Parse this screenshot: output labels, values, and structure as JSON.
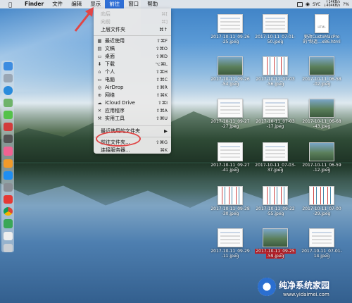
{
  "menubar": {
    "app_name": "Finder",
    "items": [
      "文件",
      "编辑",
      "显示",
      "前往",
      "窗口",
      "帮助"
    ],
    "active_item": "前往",
    "status_net_up": "↑14KB/s",
    "status_net_down": "↓404KB/s",
    "status_sync": "SYC",
    "status_percent": "?%"
  },
  "go_menu": {
    "items": [
      {
        "label": "向后",
        "shortcut": "⌘[",
        "enabled": false,
        "icon": ""
      },
      {
        "label": "向前",
        "shortcut": "⌘]",
        "enabled": false,
        "icon": ""
      },
      {
        "label": "上层文件夹",
        "shortcut": "⌘↑",
        "enabled": true,
        "icon": ""
      },
      {
        "label": "最近使用",
        "shortcut": "⇧⌘F",
        "enabled": true,
        "icon": "recents-icon"
      },
      {
        "label": "文稿",
        "shortcut": "⇧⌘O",
        "enabled": true,
        "icon": "documents-icon"
      },
      {
        "label": "桌面",
        "shortcut": "⇧⌘D",
        "enabled": true,
        "icon": "desktop-icon"
      },
      {
        "label": "下载",
        "shortcut": "⌥⌘L",
        "enabled": true,
        "icon": "downloads-icon"
      },
      {
        "label": "个人",
        "shortcut": "⇧⌘H",
        "enabled": true,
        "icon": "home-icon"
      },
      {
        "label": "电脑",
        "shortcut": "⇧⌘C",
        "enabled": true,
        "icon": "computer-icon"
      },
      {
        "label": "AirDrop",
        "shortcut": "⇧⌘R",
        "enabled": true,
        "icon": "airdrop-icon"
      },
      {
        "label": "网络",
        "shortcut": "⇧⌘K",
        "enabled": true,
        "icon": "network-icon"
      },
      {
        "label": "iCloud Drive",
        "shortcut": "⇧⌘I",
        "enabled": true,
        "icon": "icloud-icon"
      },
      {
        "label": "应用程序",
        "shortcut": "⇧⌘A",
        "enabled": true,
        "icon": "applications-icon"
      },
      {
        "label": "实用工具",
        "shortcut": "⇧⌘U",
        "enabled": true,
        "icon": "utilities-icon"
      },
      {
        "label": "最近使用的文件夹",
        "shortcut": "▶",
        "enabled": true,
        "icon": ""
      },
      {
        "label": "前往文件夹...",
        "shortcut": "⇧⌘G",
        "enabled": true,
        "icon": ""
      },
      {
        "label": "连接服务器...",
        "shortcut": "⌘K",
        "enabled": true,
        "icon": ""
      }
    ]
  },
  "desktop_files": [
    {
      "name": "2017-10-11_09-26-25.jpeg",
      "line1": "2017-10-11_09-26",
      "line2": "-25.jpeg",
      "kind": "shot"
    },
    {
      "name": "2017-10-11_07-01-50.jpeg",
      "line1": "2017-10-11_07-01-",
      "line2": "50.jpeg",
      "kind": "shot"
    },
    {
      "name": "更改CustoMacPro的\"制造...x86.html",
      "line1": "更改CustoMacPro",
      "line2": "的\"制造...x86.html",
      "kind": "doc"
    },
    {
      "name": "2017-10-11_09-26-54.jpeg",
      "line1": "2017-10-11_09-26",
      "line2": "-54.jpeg",
      "kind": "photo"
    },
    {
      "name": "2017-10-11_07-03-56.jpeg",
      "line1": "2017-10-11_07-03",
      "line2": "-56.jpeg",
      "kind": "grid"
    },
    {
      "name": "2017-10-11_06-58-02.jpeg",
      "line1": "2017-10-11_06-58",
      "line2": "-02.jpeg",
      "kind": "photo"
    },
    {
      "name": "2017-10-11_09-27-27.jpeg",
      "line1": "2017-10-11_09-27",
      "line2": "-27.jpeg",
      "kind": "shot"
    },
    {
      "name": "2017-10-11_07-03-17.jpeg",
      "line1": "2017-10-11_07-03",
      "line2": "-17.jpeg",
      "kind": "shot"
    },
    {
      "name": "2017-10-11_06-68-43.jpeg",
      "line1": "2017-10-11_06-68",
      "line2": "-43.jpeg",
      "kind": "photo"
    },
    {
      "name": "2017-10-11_09-27-41.jpeg",
      "line1": "2017-10-11_09-27",
      "line2": "-41.jpeg",
      "kind": "shot"
    },
    {
      "name": "2017-10-11_07-03-37.jpeg",
      "line1": "2017-10-11_07-03-",
      "line2": "37.jpeg",
      "kind": "shot"
    },
    {
      "name": "2017-10-11_06-59-12.jpeg",
      "line1": "2017-10-11_06-59",
      "line2": "-12.jpeg",
      "kind": "photo"
    },
    {
      "name": "2017-10-11_09-28-30.jpeg",
      "line1": "2017-10-11_09-28",
      "line2": "-30.jpeg",
      "kind": "grid"
    },
    {
      "name": "2017-10-11_09-22-55.jpeg",
      "line1": "2017-10-11_09-22",
      "line2": "-55.jpeg",
      "kind": "grid"
    },
    {
      "name": "2017-10-11_07-00-29.jpeg",
      "line1": "2017-10-11_07-00",
      "line2": "-29.jpeg",
      "kind": "grid"
    },
    {
      "name": "2017-10-11_09-29-11.jpeg",
      "line1": "2017-10-11_09-29",
      "line2": "-11.jpeg",
      "kind": "shot"
    },
    {
      "name": "2017-10-11_09-25-59.jpeg",
      "line1": "2017-10-11_09-25",
      "line2": "-59.jpeg",
      "kind": "photo",
      "selected": true
    },
    {
      "name": "2017-10-11_07-01-14.jpeg",
      "line1": "2017-10-11_07-01-",
      "line2": "14.jpeg",
      "kind": "shot"
    }
  ],
  "watermark": {
    "title": "纯净系统家园",
    "url": "www.yidaimei.com"
  },
  "colors": {
    "menu_highlight": "#2f6fd6",
    "annotation_red": "#e04646",
    "selected_label": "#c0202a"
  }
}
